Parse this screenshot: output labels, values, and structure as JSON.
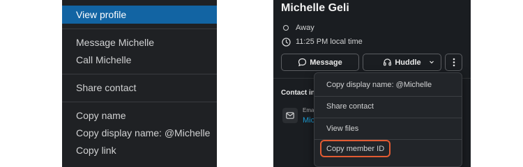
{
  "left_menu": {
    "items": [
      {
        "label": "View profile",
        "active": true
      },
      {
        "label": "Message Michelle"
      },
      {
        "label": "Call Michelle"
      },
      {
        "label": "Share contact"
      },
      {
        "label": "Copy name"
      },
      {
        "label": "Copy display name: @Michelle"
      },
      {
        "label": "Copy link"
      }
    ]
  },
  "profile": {
    "name": "Michelle Geli",
    "status": "Away",
    "local_time": "11:25 PM local time",
    "buttons": {
      "message": "Message",
      "huddle": "Huddle"
    },
    "contact_heading": "Contact in",
    "email_label": "Ema",
    "email_value": "Mic"
  },
  "dropdown": {
    "items": [
      {
        "label": "Copy display name: @Michelle"
      },
      {
        "label": "Share contact"
      },
      {
        "label": "View files"
      },
      {
        "label": "Copy member ID",
        "highlighted": true
      }
    ]
  },
  "icons": {
    "status": "away-dot-icon",
    "time": "clock-icon",
    "message": "message-bubble-icon",
    "huddle": "headphones-icon",
    "more": "vertical-ellipsis-icon",
    "email": "envelope-icon"
  },
  "colors": {
    "active_item": "#1264a3",
    "highlight_border": "#e25b32",
    "email_link": "#1d9bd1"
  }
}
